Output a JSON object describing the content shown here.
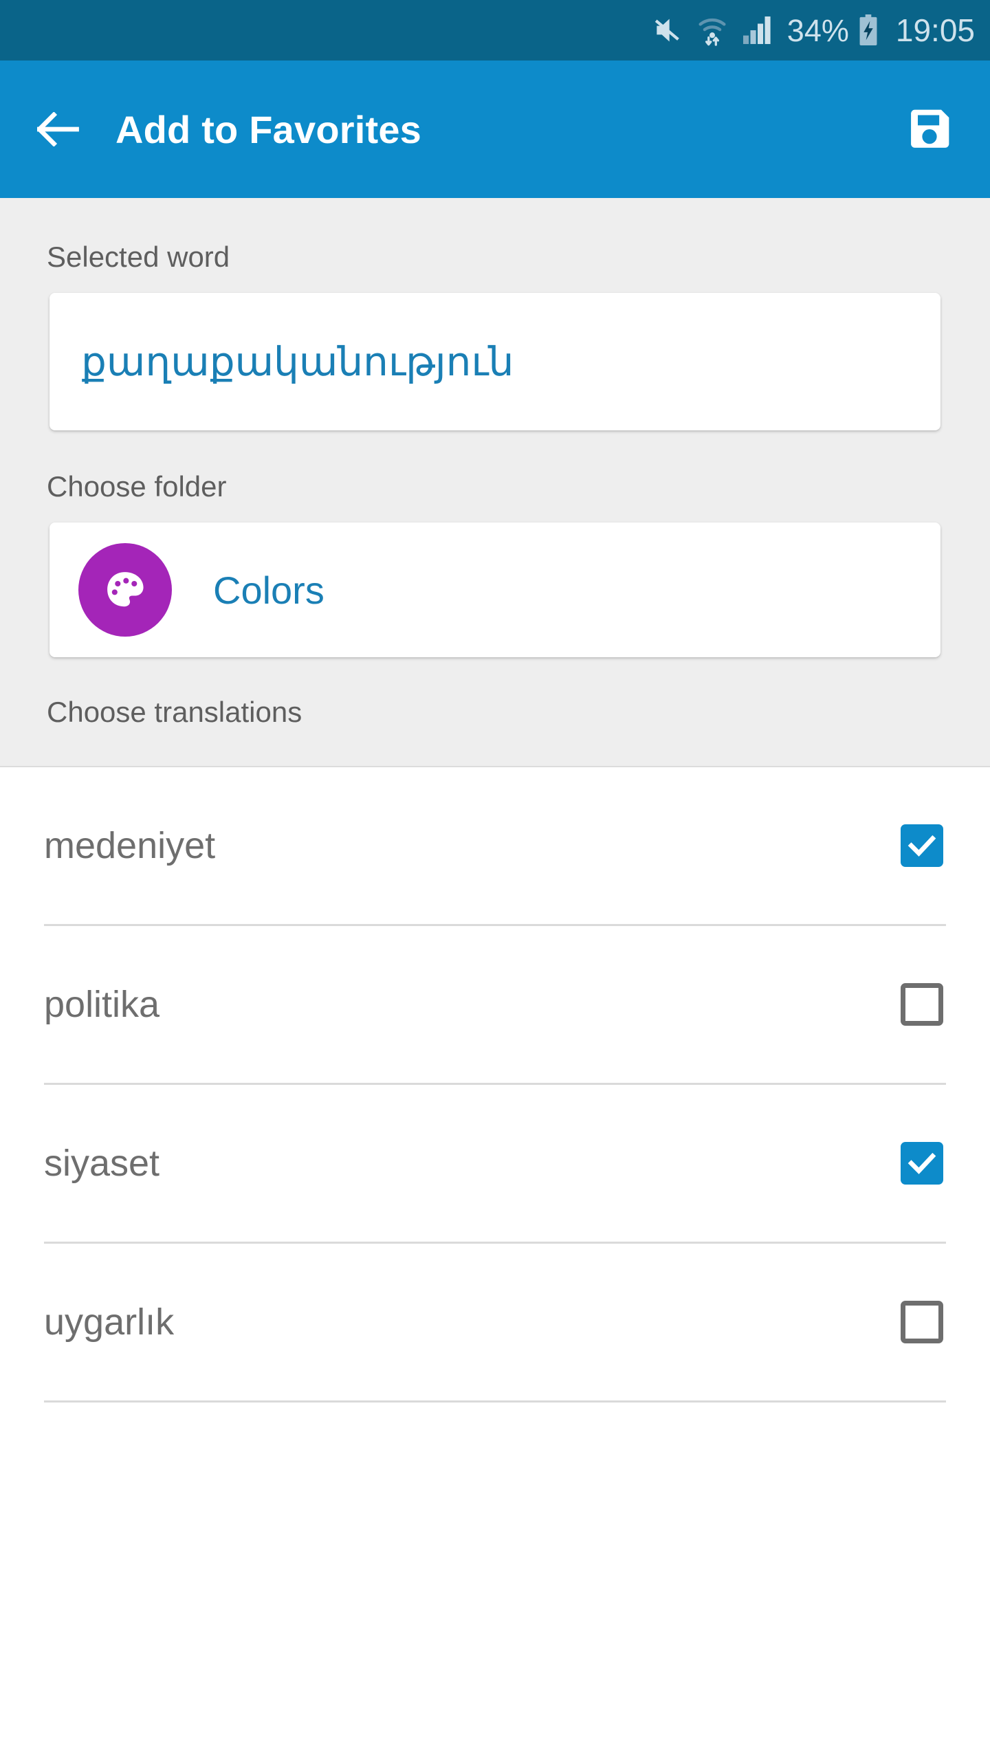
{
  "status_bar": {
    "icons": [
      "mute-icon",
      "wifi-icon",
      "signal-icon",
      "battery-charging-icon"
    ],
    "battery_percent": "34%",
    "time": "19:05",
    "background_color": "#0a6489",
    "foreground_color": "#cfe2ec"
  },
  "app_bar": {
    "back_icon": "back-arrow-icon",
    "title": "Add to Favorites",
    "save_icon": "save-floppy-icon",
    "background_color": "#0d8bca",
    "title_color": "#ffffff"
  },
  "form": {
    "selected_word": {
      "label": "Selected word",
      "value": "քաղաքականություն",
      "value_color": "#1a7fb5"
    },
    "choose_folder": {
      "label": "Choose folder",
      "folder_name": "Colors",
      "folder_icon": "palette-icon",
      "avatar_color": "#a425b8",
      "name_color": "#1a7fb5"
    },
    "choose_translations": {
      "label": "Choose translations"
    }
  },
  "translations": [
    {
      "label": "medeniyet",
      "checked": true
    },
    {
      "label": "politika",
      "checked": false
    },
    {
      "label": "siyaset",
      "checked": true
    },
    {
      "label": "uygarlık",
      "checked": false
    }
  ],
  "colors": {
    "accent": "#0d8bca",
    "panel_background": "#eeeeee",
    "list_background": "#ffffff",
    "divider": "#dadada",
    "label_text": "#5e5e5e",
    "item_text": "#6e6e6e"
  }
}
